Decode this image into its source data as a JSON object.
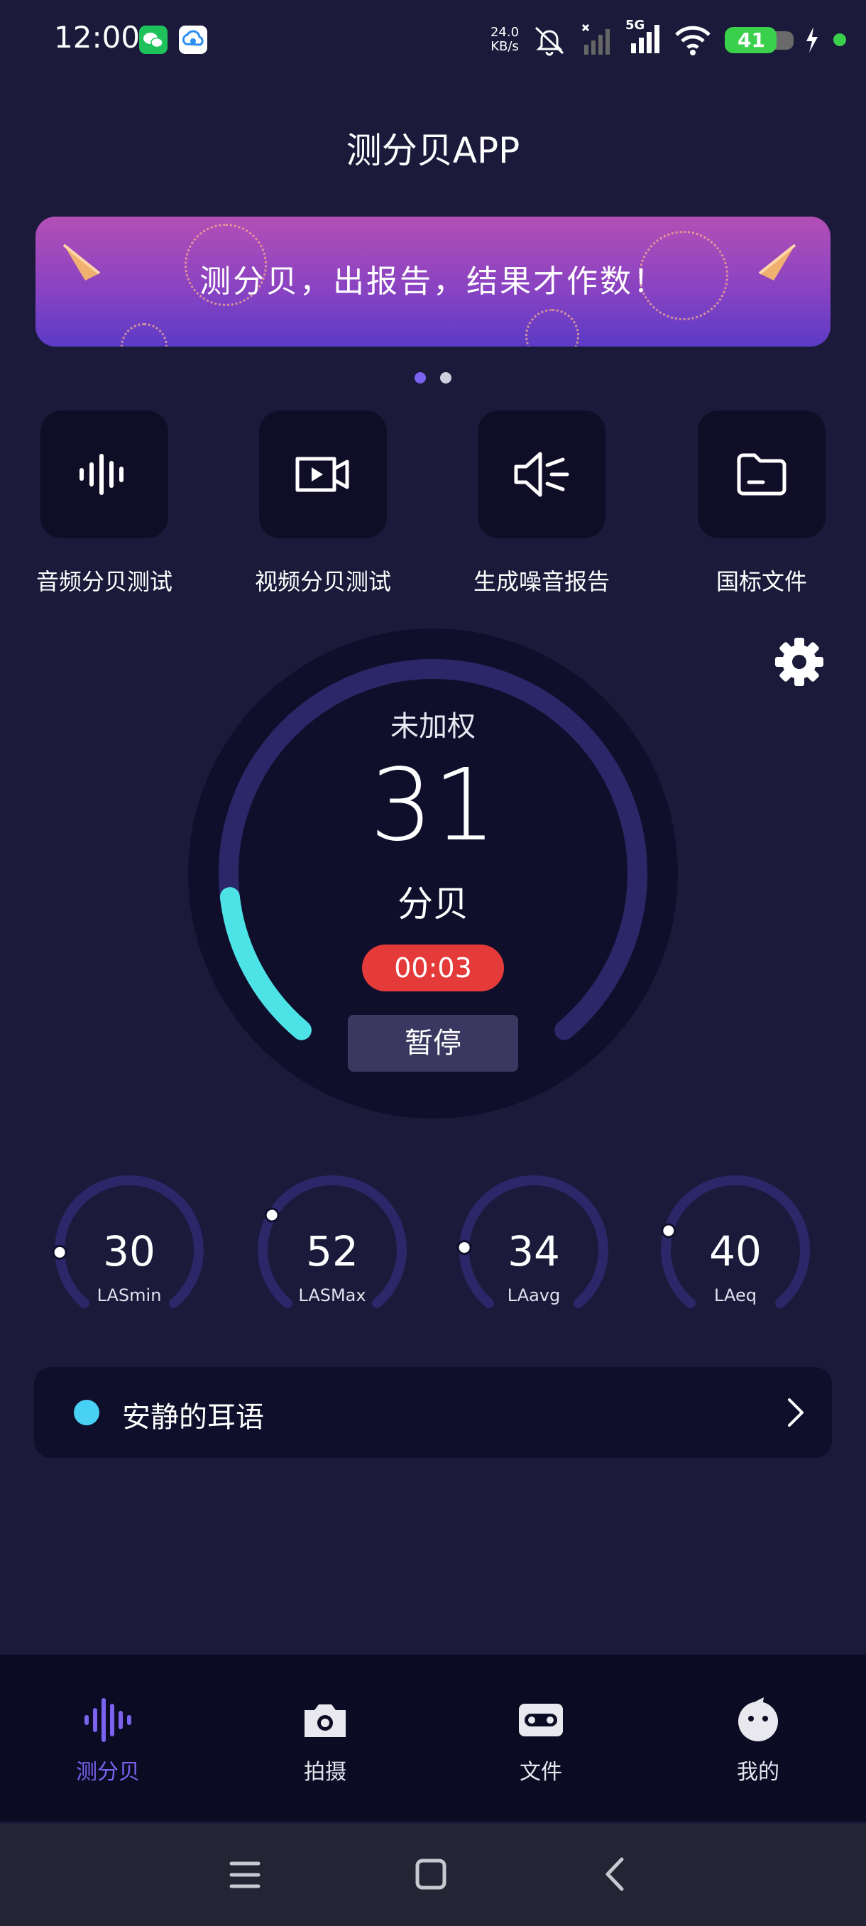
{
  "status_bar": {
    "time": "12:00",
    "net_speed_value": "24.0",
    "net_speed_unit": "KB/s",
    "network": "5G",
    "battery": "41"
  },
  "header": {
    "title": "测分贝APP"
  },
  "banner": {
    "text": "测分贝，出报告，结果才作数！"
  },
  "quick_actions": [
    {
      "label": "音频分贝测试",
      "icon": "waveform-icon"
    },
    {
      "label": "视频分贝测试",
      "icon": "video-icon"
    },
    {
      "label": "生成噪音报告",
      "icon": "speaker-icon"
    },
    {
      "label": "国标文件",
      "icon": "folder-icon"
    }
  ],
  "meter": {
    "weighting": "未加权",
    "value": "31",
    "unit": "分贝",
    "timer": "00:03",
    "pause_label": "暂停",
    "level_fraction": 0.155
  },
  "stats": [
    {
      "value": "30",
      "label": "LASmin"
    },
    {
      "value": "52",
      "label": "LASMax"
    },
    {
      "value": "34",
      "label": "LAavg"
    },
    {
      "value": "40",
      "label": "LAeq"
    }
  ],
  "status_card": {
    "text": "安静的耳语"
  },
  "bottom_nav": [
    {
      "label": "测分贝",
      "icon": "waveform-icon",
      "active": true
    },
    {
      "label": "拍摄",
      "icon": "camera-icon",
      "active": false
    },
    {
      "label": "文件",
      "icon": "tape-icon",
      "active": false
    },
    {
      "label": "我的",
      "icon": "profile-icon",
      "active": false
    }
  ],
  "colors": {
    "background": "#1b1a3a",
    "accent": "#7b63f0",
    "gauge_track": "#2b2768",
    "gauge_fill": "#4de3e6",
    "timer_bg": "#e53a3a"
  }
}
